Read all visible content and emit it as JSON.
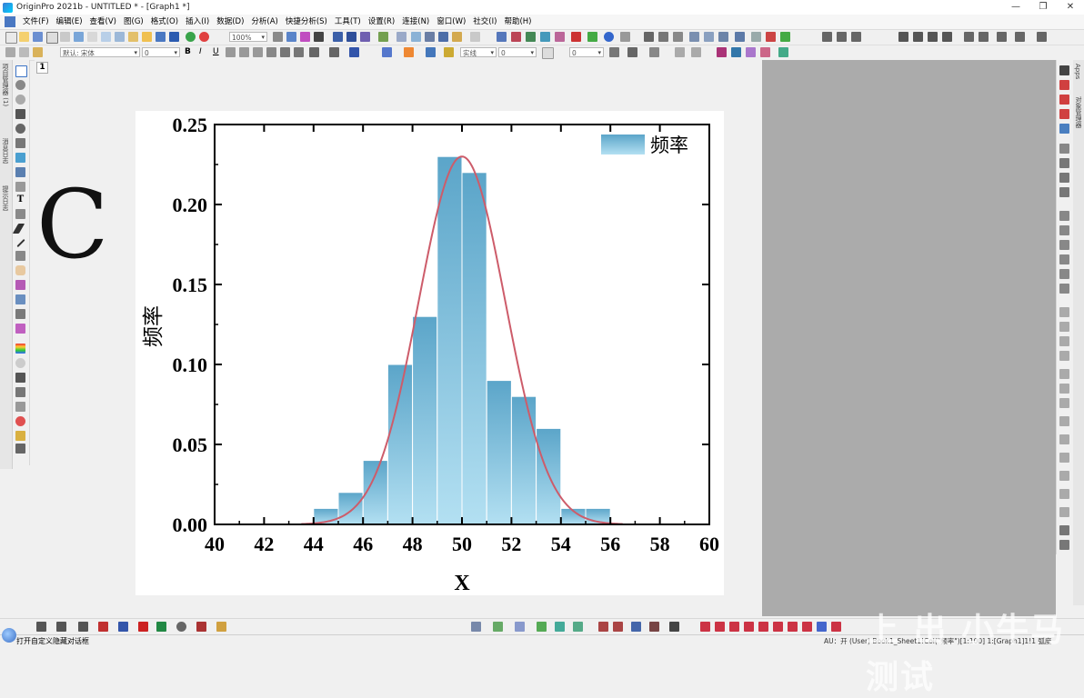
{
  "window": {
    "title": "OriginPro 2021b - UNTITLED * - [Graph1 *]",
    "controls": [
      "—",
      "❐",
      "✕"
    ]
  },
  "menu": [
    "文件(F)",
    "编辑(E)",
    "查看(V)",
    "图(G)",
    "格式(O)",
    "插入(I)",
    "数据(D)",
    "分析(A)",
    "快捷分析(S)",
    "工具(T)",
    "设置(R)",
    "连接(N)",
    "窗口(W)",
    "社交(I)",
    "帮助(H)"
  ],
  "toolbar": {
    "zoom": "100%"
  },
  "format_toolbar": {
    "font": "默认: 宋体",
    "font_size": "0",
    "bold": "B",
    "italic": "I",
    "underline": "U",
    "line_style": "实线",
    "line_width": "0"
  },
  "side_panels": {
    "left_top": "项目管理器 (1)",
    "left_mid": "消息日志",
    "left_bottom": "提示日志",
    "right_top": "Apps",
    "right_mid": "对象管理器"
  },
  "page_tab": "1",
  "panel_label": "C",
  "chart_data": {
    "type": "bar",
    "x": [
      44.5,
      45.5,
      46.5,
      47.5,
      48.5,
      49.5,
      50.5,
      51.5,
      52.5,
      53.5,
      54.5,
      55.5
    ],
    "values": [
      0.01,
      0.02,
      0.04,
      0.1,
      0.13,
      0.23,
      0.22,
      0.09,
      0.08,
      0.06,
      0.01,
      0.01
    ],
    "bin_width": 1,
    "series": [
      {
        "name": "频率",
        "type": "histogram"
      }
    ],
    "fit_curve": {
      "type": "normal",
      "mean": 50,
      "sd": 1.75,
      "peak": 0.23,
      "color": "#cd5c6a"
    },
    "xlabel": "X",
    "ylabel": "频率",
    "xlim": [
      40,
      60
    ],
    "ylim": [
      0,
      0.25
    ],
    "xticks": [
      "40",
      "42",
      "44",
      "46",
      "48",
      "50",
      "52",
      "54",
      "56",
      "58",
      "60"
    ],
    "yticks": [
      "0.00",
      "0.05",
      "0.10",
      "0.15",
      "0.20",
      "0.25"
    ],
    "legend_position": "top-right",
    "bar_color_top": "#5ba5c9",
    "bar_color_bottom": "#b3e0f2",
    "grid": false
  },
  "status": {
    "message": "打开自定义隐藏对话框",
    "info": "AU：开  (User)  Book1_Sheet1!Col(\"频率\")[1:100]  1:[Graph1]1!1  弧度"
  },
  "watermark": "上 出 小牛马测试"
}
